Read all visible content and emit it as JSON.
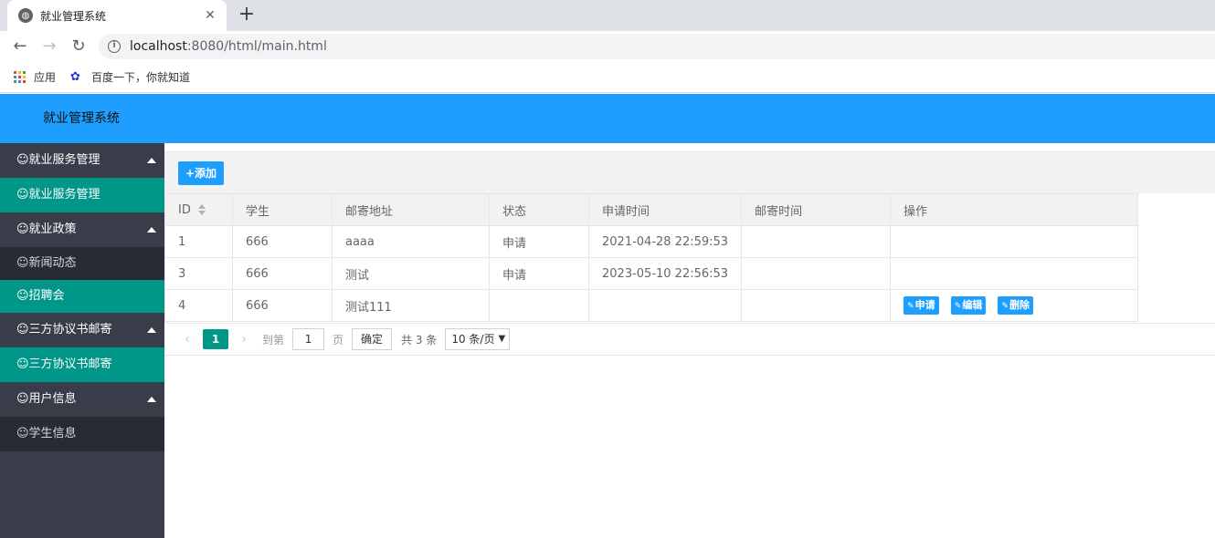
{
  "browser": {
    "tab_title": "就业管理系统",
    "url_host": "localhost",
    "url_rest": ":8080/html/main.html",
    "bookmarks": [
      {
        "label": "应用",
        "icon": "apps-grid-icon"
      },
      {
        "label": "百度一下，你就知道",
        "icon": "baidu-paw-icon"
      }
    ]
  },
  "app": {
    "title": "就业管理系统"
  },
  "sidebar": {
    "items": [
      {
        "label": "☺就业服务管理",
        "kind": "group"
      },
      {
        "label": "☺就业服务管理",
        "kind": "active"
      },
      {
        "label": "☺就业政策",
        "kind": "group"
      },
      {
        "label": "☺新闻动态",
        "kind": "child"
      },
      {
        "label": "☺招聘会",
        "kind": "active"
      },
      {
        "label": "☺三方协议书邮寄",
        "kind": "group"
      },
      {
        "label": "☺三方协议书邮寄",
        "kind": "active"
      },
      {
        "label": "☺用户信息",
        "kind": "group"
      },
      {
        "label": "☺学生信息",
        "kind": "child"
      }
    ]
  },
  "toolbar": {
    "add_label": "+添加"
  },
  "table": {
    "headers": [
      "ID",
      "学生",
      "邮寄地址",
      "状态",
      "申请时间",
      "邮寄时间",
      "操作"
    ],
    "rows": [
      {
        "id": "1",
        "student": "666",
        "address": "aaaa",
        "status": "申请",
        "apply_time": "2021-04-28 22:59:53",
        "mail_time": ""
      },
      {
        "id": "3",
        "student": "666",
        "address": "测试",
        "status": "申请",
        "apply_time": "2023-05-10 22:56:53",
        "mail_time": ""
      },
      {
        "id": "4",
        "student": "666",
        "address": "测试111",
        "status": "",
        "apply_time": "",
        "mail_time": ""
      }
    ],
    "row_actions": [
      "申请",
      "编辑",
      "删除"
    ]
  },
  "pager": {
    "current_page": "1",
    "goto_label": "到第",
    "goto_value": "1",
    "page_label": "页",
    "confirm_label": "确定",
    "total_label": "共 3 条",
    "limit_label": "10 条/页"
  },
  "colors": {
    "header_blue": "#1e9fff",
    "sidebar_dark": "#393d49",
    "active_teal": "#009688"
  }
}
